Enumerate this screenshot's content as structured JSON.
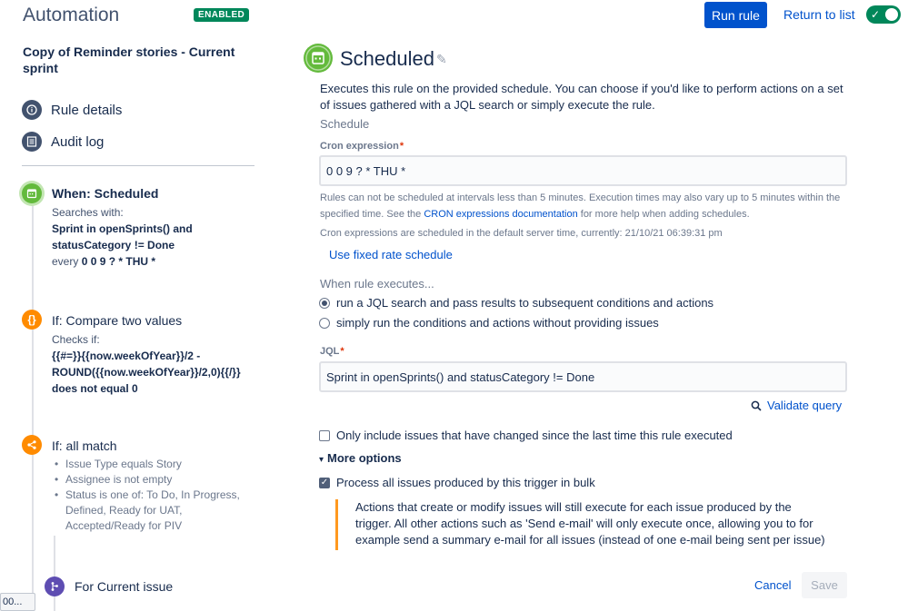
{
  "header": {
    "title": "Automation",
    "badge": "ENABLED",
    "run_rule": "Run rule",
    "return_link": "Return to list",
    "toggle_on": true
  },
  "sidebar": {
    "rule_name": "Copy of Reminder stories - Current sprint",
    "links": [
      {
        "label": "Rule details",
        "icon": "info-icon"
      },
      {
        "label": "Audit log",
        "icon": "list-icon"
      }
    ],
    "steps": [
      {
        "title": "When: Scheduled",
        "icon": "calendar-icon",
        "color": "#63ba3c",
        "body": [
          "Searches with:",
          "Sprint in openSprints() and",
          "statusCategory != Done",
          "every ",
          "0 0 9 ? * THU *"
        ]
      },
      {
        "title": "If: Compare two values",
        "icon": "braces-icon",
        "color": "#ff8b00",
        "body": [
          "Checks if:",
          "{{#=}}{{now.weekOfYear}}/2 -",
          "ROUND({{now.weekOfYear}}/2,0){{/}}",
          "does not equal 0"
        ]
      },
      {
        "title": "If: all match",
        "icon": "share-icon",
        "color": "#ff8b00",
        "bullets": [
          "Issue Type equals Story",
          "Assignee is not empty",
          "Status is one of: To Do, In Progress,",
          "Defined, Ready for UAT,",
          "Accepted/Ready for PIV"
        ]
      }
    ],
    "branch": {
      "title": "For Current issue",
      "icon": "branch-icon",
      "color": "#5e4db2"
    },
    "status_chip": "00..."
  },
  "main": {
    "title": "Scheduled",
    "description": "Executes this rule on the provided schedule. You can choose if you'd like to perform actions on a set of issues gathered with a JQL search or simply execute the rule.",
    "schedule_label": "Schedule",
    "cron_label": "Cron expression",
    "cron_value": "0 0 9 ? * THU *",
    "cron_help_1": "Rules can not be scheduled at intervals less than 5 minutes. Execution times may also vary up to 5 minutes within the specified time. See the ",
    "cron_help_link": "CRON expressions documentation",
    "cron_help_2": " for more help when adding schedules.",
    "server_time": "Cron expressions are scheduled in the default server time, currently: 21/10/21 06:39:31 pm",
    "fixed_rate_link": "Use fixed rate schedule",
    "when_executes": "When rule executes...",
    "radio_1": "run a JQL search and pass results to subsequent conditions and actions",
    "radio_2": "simply run the conditions and actions without providing issues",
    "jql_label": "JQL",
    "jql_value": "Sprint in openSprints() and statusCategory != Done",
    "validate": "Validate query",
    "only_include": "Only include issues that have changed since the last time this rule executed",
    "more_options": "More options",
    "process_bulk": "Process all issues produced by this trigger in bulk",
    "note": "Actions that create or modify issues will still execute for each issue produced by the trigger. All other actions such as 'Send e-mail' will only execute once, allowing you to for example send a summary e-mail for all issues (instead of one e-mail being sent per issue)",
    "cancel": "Cancel",
    "save": "Save"
  }
}
